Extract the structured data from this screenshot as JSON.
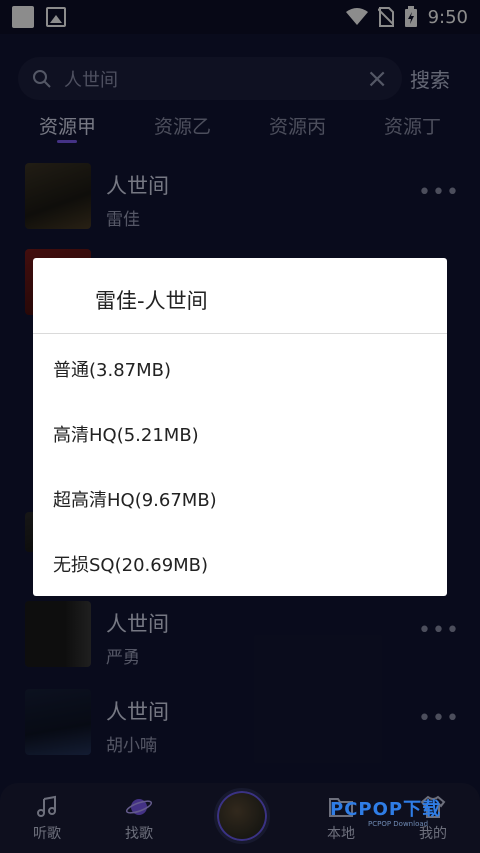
{
  "status_bar": {
    "time": "9:50"
  },
  "search": {
    "query": "人世间",
    "button_label": "搜索"
  },
  "tabs": [
    {
      "label": "资源甲",
      "active": true
    },
    {
      "label": "资源乙",
      "active": false
    },
    {
      "label": "资源丙",
      "active": false
    },
    {
      "label": "资源丁",
      "active": false
    }
  ],
  "songs": [
    {
      "title": "人世间",
      "artist": "雷佳"
    },
    {
      "title": "人世间",
      "artist": "严勇"
    },
    {
      "title": "人世间",
      "artist": "胡小喃"
    }
  ],
  "dialog": {
    "title": "雷佳-人世间",
    "options": [
      "普通(3.87MB)",
      "高清HQ(5.21MB)",
      "超高清HQ(9.67MB)",
      "无损SQ(20.69MB)"
    ]
  },
  "bottom_nav": {
    "items": [
      {
        "label": "听歌",
        "icon": "music-note-icon"
      },
      {
        "label": "找歌",
        "icon": "planet-icon"
      },
      {
        "label": "本地",
        "icon": "folder-icon"
      },
      {
        "label": "我的",
        "icon": "shirt-icon"
      }
    ]
  },
  "watermark": {
    "brand": "PCPOP下载",
    "sub": "PCPOP Download"
  },
  "colors": {
    "background": "#121533",
    "accent": "#7d5cf3",
    "dialog_bg": "#ffffff"
  }
}
